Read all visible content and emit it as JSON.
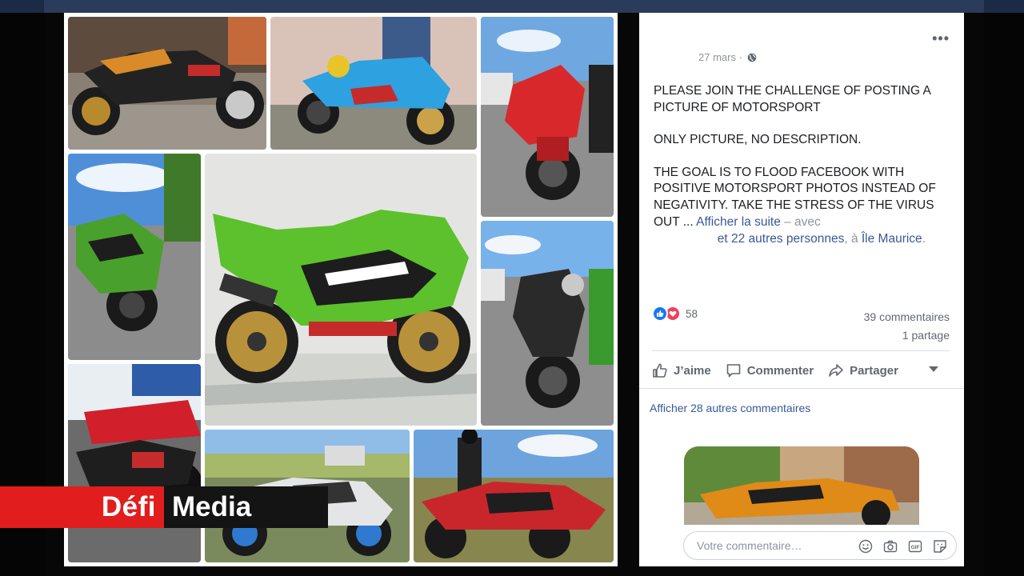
{
  "post": {
    "date": "27 mars",
    "text_line1": "PLEASE JOIN THE CHALLENGE OF POSTING A PICTURE OF MOTORSPORT",
    "text_line2": "ONLY PICTURE, NO DESCRIPTION.",
    "text_line3": "THE GOAL IS TO FLOOD FACEBOOK WITH POSITIVE MOTORSPORT PHOTOS INSTEAD OF NEGATIVITY. TAKE THE STRESS OF THE VIRUS OUT ...",
    "see_more": "Afficher la suite",
    "with_text": "– avec",
    "tagged_others": "et 22 autres personnes",
    "location_prefix": ", à",
    "location": "Île Maurice",
    "reactions_count": "58",
    "comments_count": "39 commentaires",
    "shares_count": "1 partage"
  },
  "actions": {
    "like": "J’aime",
    "comment": "Commenter",
    "share": "Partager"
  },
  "comments": {
    "more_label": "Afficher 28 autres commentaires",
    "composer_placeholder": "Votre commentaire…"
  },
  "brand": {
    "part1": "Défi",
    "part2": "Media",
    "red": "#e11d1d"
  },
  "colors": {
    "link": "#385898",
    "like_blue": "#1877f2",
    "love_red": "#f33e58"
  }
}
